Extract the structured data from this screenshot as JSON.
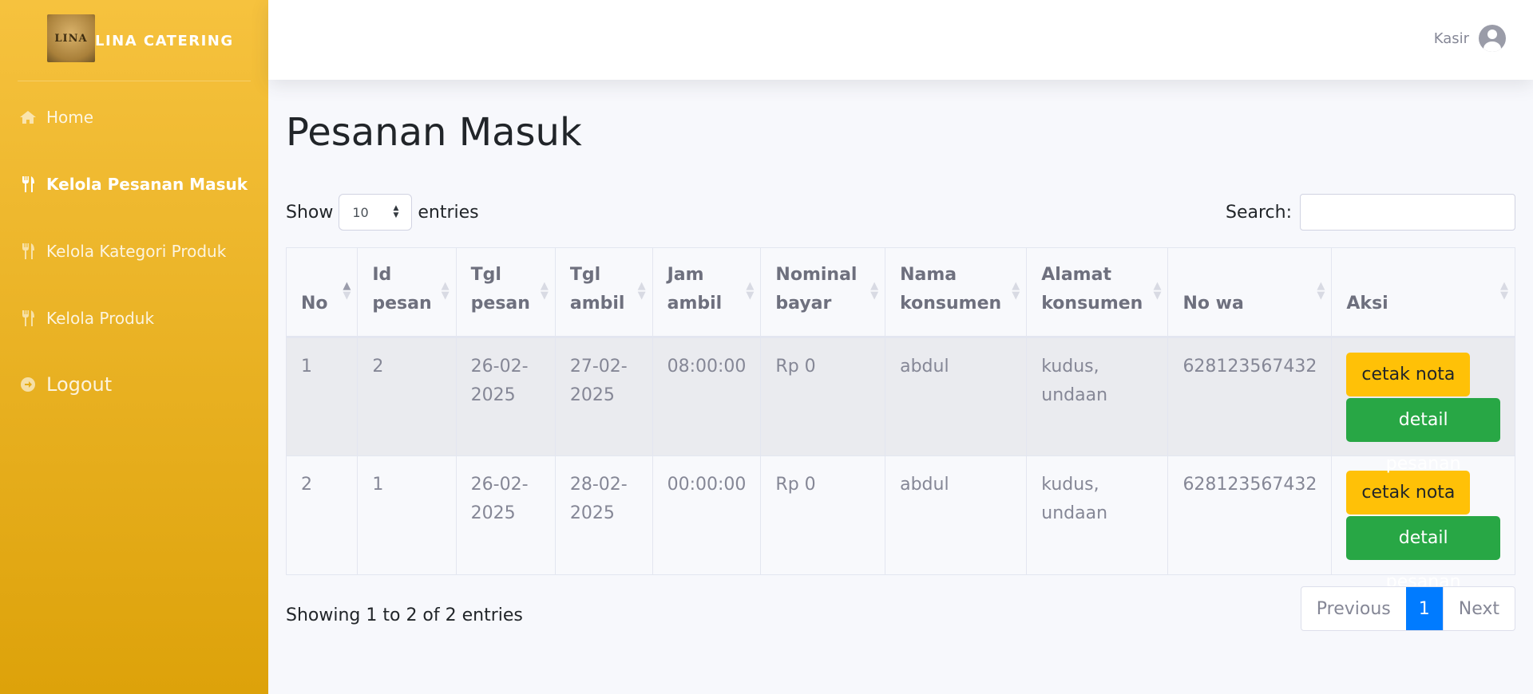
{
  "sidebar": {
    "brand_logo_text": "LINA",
    "brand_name": "LINA CATERING",
    "items": [
      {
        "label": "Home",
        "icon": "home-icon",
        "active": false
      },
      {
        "label": "Kelola Pesanan Masuk",
        "icon": "utensils-icon",
        "active": true
      },
      {
        "label": "Kelola Kategori Produk",
        "icon": "utensils-icon",
        "active": false
      },
      {
        "label": "Kelola Produk",
        "icon": "utensils-icon",
        "active": false
      }
    ],
    "logout_label": "Logout"
  },
  "topbar": {
    "user_name": "Kasir",
    "avatar_icon": "user-circle-icon"
  },
  "page": {
    "title": "Pesanan Masuk"
  },
  "table_controls": {
    "show_label": "Show",
    "entries_value": "10",
    "entries_label": "entries",
    "search_label": "Search:",
    "search_value": "",
    "search_placeholder": ""
  },
  "table": {
    "headers": [
      {
        "line1": "",
        "line2": "No"
      },
      {
        "line1": "Id",
        "line2": "pesan"
      },
      {
        "line1": "Tgl",
        "line2": "pesan"
      },
      {
        "line1": "Tgl",
        "line2": "ambil"
      },
      {
        "line1": "Jam",
        "line2": "ambil"
      },
      {
        "line1": "Nominal",
        "line2": "bayar"
      },
      {
        "line1": "Nama",
        "line2": "konsumen"
      },
      {
        "line1": "Alamat",
        "line2": "konsumen"
      },
      {
        "line1": "",
        "line2": "No wa"
      },
      {
        "line1": "",
        "line2": "Aksi"
      }
    ],
    "rows": [
      {
        "no": "1",
        "id_pesan": "2",
        "tgl_pesan_1": "26-02-",
        "tgl_pesan_2": "2025",
        "tgl_ambil_1": "27-02-",
        "tgl_ambil_2": "2025",
        "jam_ambil": "08:00:00",
        "nominal": "Rp 0",
        "nama": "abdul",
        "alamat_1": "kudus,",
        "alamat_2": "undaan",
        "no_wa": "628123567432",
        "btn_nota": "cetak nota",
        "btn_detail": "detail pesanan"
      },
      {
        "no": "2",
        "id_pesan": "1",
        "tgl_pesan_1": "26-02-",
        "tgl_pesan_2": "2025",
        "tgl_ambil_1": "28-02-",
        "tgl_ambil_2": "2025",
        "jam_ambil": "00:00:00",
        "nominal": "Rp 0",
        "nama": "abdul",
        "alamat_1": "kudus,",
        "alamat_2": "undaan",
        "no_wa": "628123567432",
        "btn_nota": "cetak nota",
        "btn_detail": "detail pesanan"
      }
    ]
  },
  "footer": {
    "info": "Showing 1 to 2 of 2 entries",
    "prev_label": "Previous",
    "current_page": "1",
    "next_label": "Next"
  },
  "colors": {
    "sidebar_top": "#f6c23e",
    "sidebar_bottom": "#dda20a",
    "warning": "#ffc107",
    "success": "#28a745",
    "primary": "#007bff"
  }
}
